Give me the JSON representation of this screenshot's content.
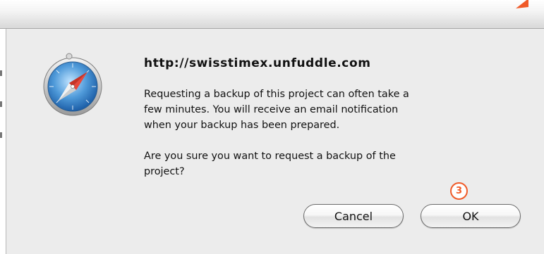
{
  "dialog": {
    "title": "http://swisstimex.unfuddle.com",
    "message_paragraph_1": "Requesting a backup of this project can often take a\nfew minutes.  You will receive an email notification\nwhen your backup has been prepared.",
    "message_paragraph_2": "Are you sure you want to request a backup of the\nproject?",
    "app_icon": "safari-compass-icon"
  },
  "step_marker": {
    "label": "3",
    "color": "#f05a28"
  },
  "buttons": {
    "cancel_label": "Cancel",
    "ok_label": "OK"
  },
  "colors": {
    "dialog_background": "#ececec",
    "accent": "#f05a28"
  }
}
